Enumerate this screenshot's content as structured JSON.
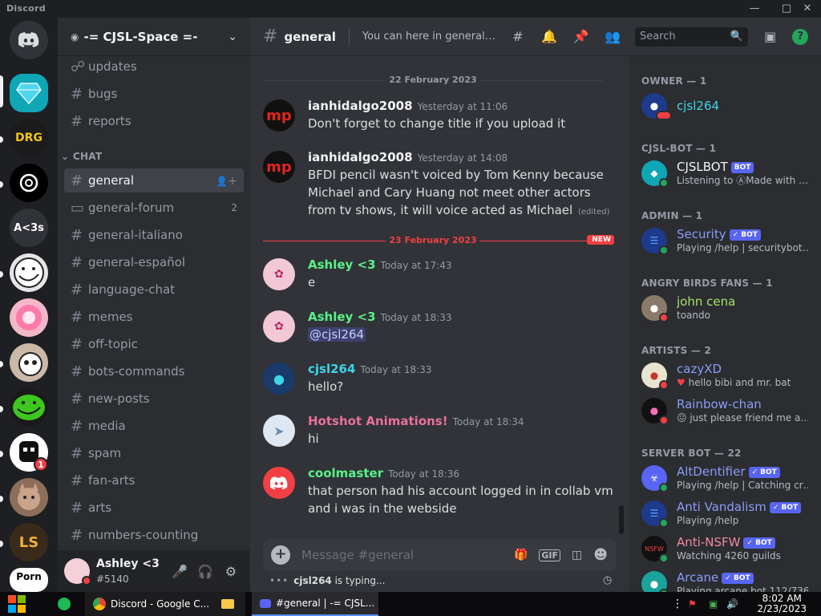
{
  "window": {
    "app_name": "Discord"
  },
  "server": {
    "name": "-= CJSL-Space =-"
  },
  "channels_top": [
    {
      "label": "updates"
    },
    {
      "label": "bugs"
    },
    {
      "label": "reports"
    }
  ],
  "category": {
    "label": "CHAT"
  },
  "channels": [
    {
      "label": "general",
      "active": true
    },
    {
      "label": "general-forum",
      "count": "2"
    },
    {
      "label": "general-italiano"
    },
    {
      "label": "general-español"
    },
    {
      "label": "language-chat"
    },
    {
      "label": "memes"
    },
    {
      "label": "off-topic"
    },
    {
      "label": "bots-commands"
    },
    {
      "label": "new-posts"
    },
    {
      "label": "media"
    },
    {
      "label": "spam"
    },
    {
      "label": "fan-arts"
    },
    {
      "label": "arts"
    },
    {
      "label": "numbers-counting"
    }
  ],
  "guild_labels": {
    "text_guild": "A<3s",
    "drg": "DRG",
    "porn": "Porn",
    "badge": "1"
  },
  "user": {
    "name": "Ashley <3",
    "tag": "#5140"
  },
  "header": {
    "channel": "general",
    "topic": "You can here in general (N...",
    "search_placeholder": "Search"
  },
  "dividers": {
    "first": "22 February 2023",
    "second": "23 February 2023",
    "new_tag": "NEW"
  },
  "messages": [
    {
      "author": "ianhidalgo2008",
      "time": "Yesterday at 11:06",
      "text": "Don't forget to change title if you upload it",
      "color": "#f2f3f5"
    },
    {
      "author": "ianhidalgo2008",
      "time": "Yesterday at 14:08",
      "text": "BFDI pencil wasn't voiced by Tom Kenny because Michael and Cary Huang not meet other actors from tv shows, it will voice acted as Michael",
      "edited": "(edited)",
      "color": "#f2f3f5"
    },
    {
      "author": "Ashley <3",
      "time": "Today at 17:43",
      "text": "e",
      "color": "#57f287"
    },
    {
      "author": "Ashley <3",
      "time": "Today at 18:33",
      "text": "@cjsl264",
      "color": "#57f287"
    },
    {
      "author": "cjsl264",
      "time": "Today at 18:33",
      "text": "hello?",
      "color": "#3ed4e8"
    },
    {
      "author": "Hotshot Animations!",
      "time": "Today at 18:34",
      "text": "hi",
      "color": "#e8719b"
    },
    {
      "author": "coolmaster",
      "time": "Today at 18:36",
      "text": "that person had his account logged in in collab vm and i was in the webside",
      "color": "#57f287"
    }
  ],
  "composer": {
    "placeholder": "Message #general",
    "gif": "GIF"
  },
  "typing": {
    "user": "cjsl264",
    "text": " is typing..."
  },
  "member_groups": [
    {
      "label": "OWNER — 1"
    },
    {
      "label": "CJSL-BOT — 1"
    },
    {
      "label": "ADMIN — 1"
    },
    {
      "label": "ANGRY BIRDS FANS — 1"
    },
    {
      "label": "ARTISTS — 2"
    },
    {
      "label": "SERVER BOT — 22"
    }
  ],
  "members": [
    {
      "name": "cjsl264",
      "sub": "",
      "color": "#3ed4e8"
    },
    {
      "name": "CJSLBOT",
      "sub": "Listening to ⒶMade with Bot...",
      "color": "#f2f3f5",
      "bot": "BOT"
    },
    {
      "name": "Security",
      "sub": "Playing /help | securitybot.gg",
      "color": "#8b9cf7",
      "bot": "✓ BOT"
    },
    {
      "name": "john cena",
      "sub": "toando",
      "color": "#a8e36c"
    },
    {
      "name": "cazyXD",
      "sub": "hello bibi and mr. bat",
      "color": "#8b9cf7"
    },
    {
      "name": "Rainbow-chan",
      "sub": "just please friend me and ...",
      "color": "#8b9cf7"
    },
    {
      "name": "AltDentifier",
      "sub": "Playing /help | Catching crimi...",
      "color": "#8b9cf7",
      "bot": "✓ BOT"
    },
    {
      "name": "Anti Vandalism",
      "sub": "Playing /help",
      "color": "#8b9cf7",
      "bot": "✓ BOT"
    },
    {
      "name": "Anti-NSFW",
      "sub": "Watching 4260 guilds",
      "color": "#f28b9c",
      "bot": "✓ BOT"
    },
    {
      "name": "Arcane",
      "sub": "Playing arcane.bot 112/736",
      "color": "#8b9cf7",
      "bot": "✓ BOT"
    }
  ],
  "taskbar": {
    "chrome_label": "Discord - Google C...",
    "discord_label": "#general | -= CJSL...",
    "time": "8:02 AM",
    "date": "2/23/2023"
  },
  "colors": {
    "accent": "#5865f2",
    "danger": "#f23f43",
    "online": "#23a55a",
    "dnd": "#f23f43"
  }
}
